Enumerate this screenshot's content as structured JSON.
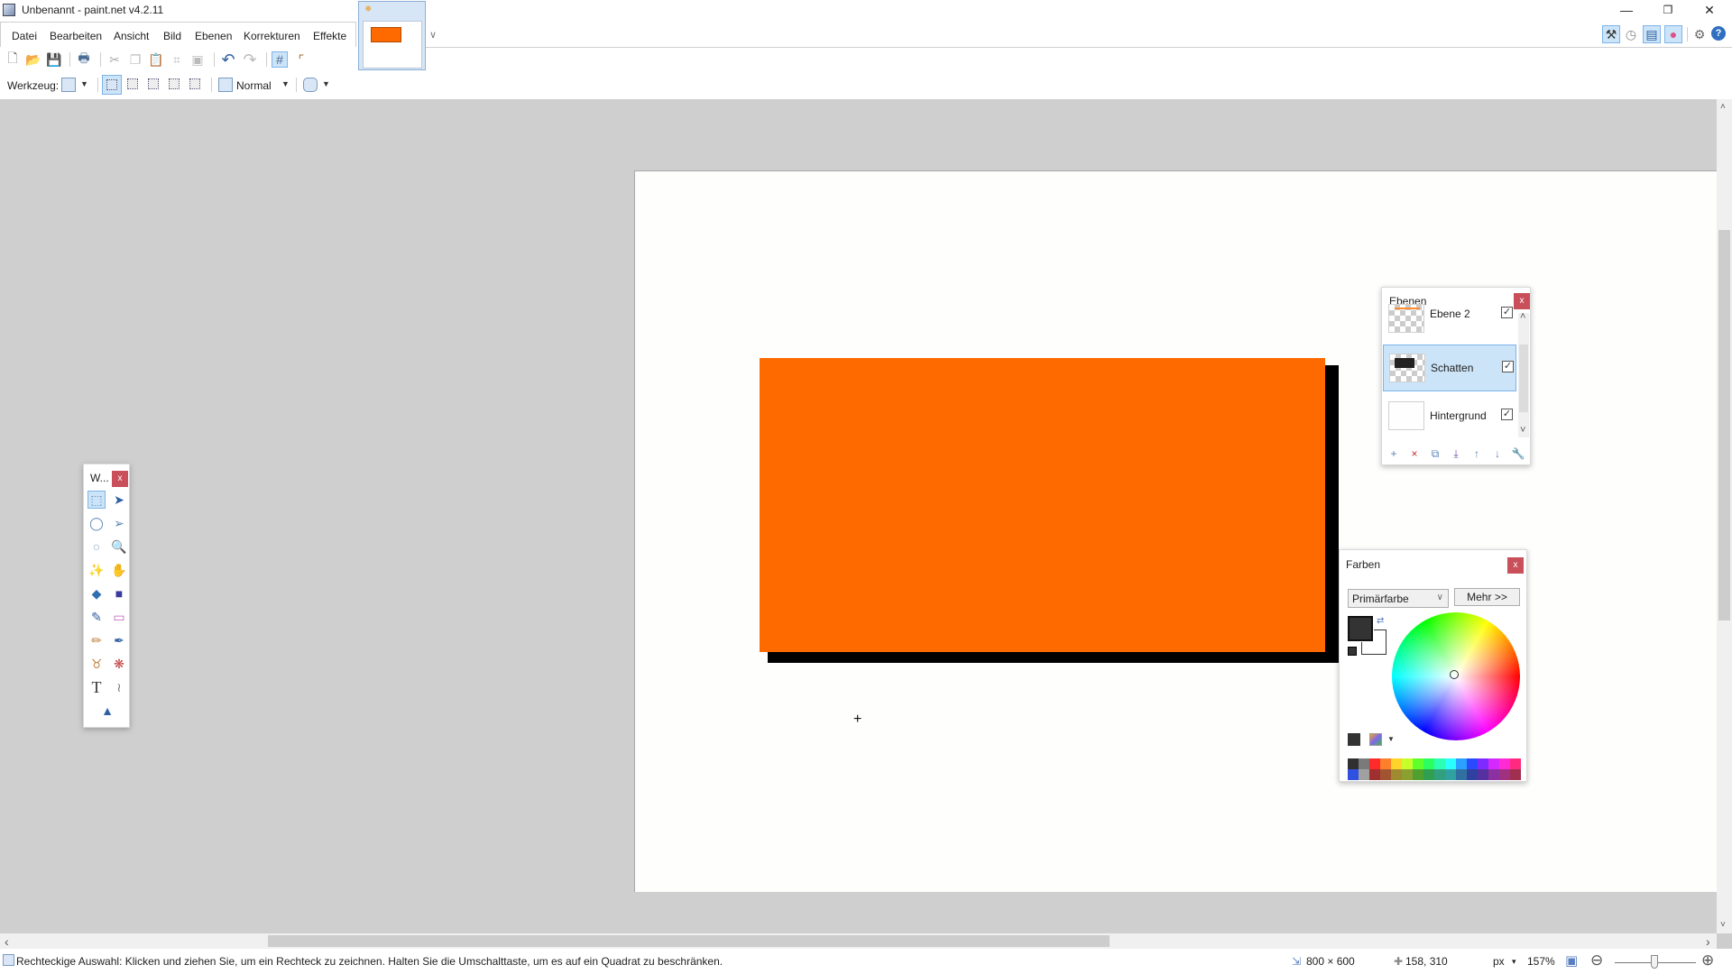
{
  "window": {
    "title": "Unbenannt - paint.net v4.2.11",
    "minimize_glyph": "—",
    "maximize_glyph": "❐",
    "close_glyph": "✕"
  },
  "menu": {
    "items": [
      "Datei",
      "Bearbeiten",
      "Ansicht",
      "Bild",
      "Ebenen",
      "Korrekturen",
      "Effekte"
    ]
  },
  "document_tab": {
    "star_glyph": "✹",
    "thumb_color": "#ff6a00",
    "tab_list_glyph": "∨"
  },
  "toolbar": {
    "new_glyph": "🗋",
    "open_glyph": "📂",
    "save_glyph": "💾",
    "print_glyph": "🖶",
    "cut_glyph": "✂",
    "copy_glyph": "❐",
    "paste_glyph": "📋",
    "crop_glyph": "⌗",
    "deselect_glyph": "▣",
    "undo_glyph": "↶",
    "redo_glyph": "↷",
    "grid_glyph": "#",
    "ruler_glyph": "⌜"
  },
  "right_toolbar": {
    "tools_glyph": "⚒",
    "history_glyph": "◷",
    "layers_glyph": "▤",
    "colors_glyph": "●",
    "settings_glyph": "⚙",
    "help_glyph": "?"
  },
  "toolbar2": {
    "tool_label": "Werkzeug:",
    "blend_mode": "Normal",
    "caret": "▼"
  },
  "canvas": {
    "background": "#fefefd",
    "rect_color": "#ff6a00",
    "shadow_color": "#000000",
    "cursor_glyph": "+"
  },
  "tools_window": {
    "title": "W...",
    "close": "x",
    "tools": [
      {
        "name": "rectangle-select",
        "glyph": "⬚"
      },
      {
        "name": "move-selected-pixels",
        "glyph": "➤"
      },
      {
        "name": "lasso-select",
        "glyph": "◯"
      },
      {
        "name": "move-selection",
        "glyph": "➢"
      },
      {
        "name": "ellipse-select",
        "glyph": "○"
      },
      {
        "name": "zoom",
        "glyph": "🔍"
      },
      {
        "name": "magic-wand",
        "glyph": "✨"
      },
      {
        "name": "pan",
        "glyph": "✋"
      },
      {
        "name": "paint-bucket",
        "glyph": "◆"
      },
      {
        "name": "gradient",
        "glyph": "■"
      },
      {
        "name": "paintbrush",
        "glyph": "✎"
      },
      {
        "name": "eraser",
        "glyph": "▭"
      },
      {
        "name": "pencil",
        "glyph": "✏"
      },
      {
        "name": "color-picker",
        "glyph": "✒"
      },
      {
        "name": "clone-stamp",
        "glyph": "♉"
      },
      {
        "name": "recolor",
        "glyph": "❋"
      },
      {
        "name": "text",
        "glyph": "T"
      },
      {
        "name": "line-curve",
        "glyph": "≀"
      },
      {
        "name": "shapes",
        "glyph": "▲"
      }
    ]
  },
  "layers": {
    "title": "Ebenen",
    "close": "x",
    "items": [
      {
        "name": "Ebene 2",
        "visible": true,
        "selected": false
      },
      {
        "name": "Schatten",
        "visible": true,
        "selected": true
      },
      {
        "name": "Hintergrund",
        "visible": true,
        "selected": false
      }
    ],
    "check_glyph": "✓",
    "scroll_up": "˄",
    "scroll_down": "˅",
    "actions": [
      "add-layer",
      "delete-layer",
      "duplicate-layer",
      "merge-layer-down",
      "move-layer-up",
      "move-layer-down",
      "layer-properties"
    ],
    "action_glyphs": [
      "+",
      "×",
      "⧉",
      "⤓",
      "↑",
      "↓",
      "🔧"
    ]
  },
  "colors": {
    "title": "Farben",
    "close": "x",
    "selector": "Primärfarbe",
    "more_button": "Mehr >>",
    "primary": "#333333",
    "secondary": "#ffffff",
    "swap_glyph": "⇄",
    "palette": [
      "#303030",
      "#7a7a7a",
      "#ff2a2a",
      "#ff7f2a",
      "#ffd42a",
      "#c8ff2a",
      "#5fff2a",
      "#2aff5f",
      "#2affb4",
      "#2affff",
      "#2a9fff",
      "#2a4aff",
      "#7f2aff",
      "#d42aff",
      "#ff2ad4",
      "#ff2a7f",
      "#3050e0",
      "#a0a0a0",
      "#a03030",
      "#a05530",
      "#a08a30",
      "#8aa030",
      "#50a030",
      "#30a050",
      "#30a080",
      "#30a0a0",
      "#3070a0",
      "#3040a0",
      "#5530a0",
      "#8a30a0",
      "#a03080",
      "#a03050"
    ]
  },
  "scrollbars": {
    "up": "˄",
    "down": "˅",
    "left": "‹",
    "right": "›"
  },
  "status": {
    "message": "Rechteckige Auswahl: Klicken und ziehen Sie, um ein Rechteck zu zeichnen. Halten Sie die Umschalttaste, um es auf ein Quadrat zu beschränken.",
    "image_size": "800 × 600",
    "cursor_position": "158, 310",
    "unit": "px",
    "unit_caret": "▾",
    "zoom": "157%",
    "zoom_out_glyph": "⊖",
    "zoom_in_glyph": "⊕",
    "size_icon_glyph": "⇲",
    "pos_icon_glyph": "✚",
    "fit_glyph": "▣"
  }
}
